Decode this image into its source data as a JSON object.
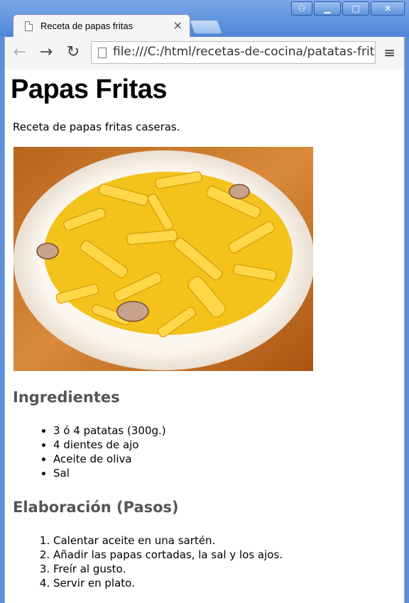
{
  "browser": {
    "tab_title": "Receta de papas fritas",
    "tab_close": "×",
    "url": "file:///C:/html/recetas-de-cocina/patatas-fritas",
    "back_icon": "←",
    "forward_icon": "→",
    "reload_icon": "↻",
    "menu_icon": "≡",
    "window_buttons": {
      "user": "⚇",
      "minimize": "▁",
      "maximize": "□",
      "close": "✕"
    }
  },
  "page": {
    "title": "Papas Fritas",
    "intro": "Receta de papas fritas caseras.",
    "photo_desc_label": "plato de papas fritas",
    "ingredients_heading": "Ingredientes",
    "ingredients": [
      "3 ó 4 patatas (300g.)",
      "4 dientes de ajo",
      "Aceite de oliva",
      "Sal"
    ],
    "steps_heading": "Elaboración (Pasos)",
    "steps": [
      "Calentar aceite en una sartén.",
      "Añadir las papas cortadas, la sal y los ajos.",
      "Freír al gusto.",
      "Servir en plato."
    ]
  }
}
